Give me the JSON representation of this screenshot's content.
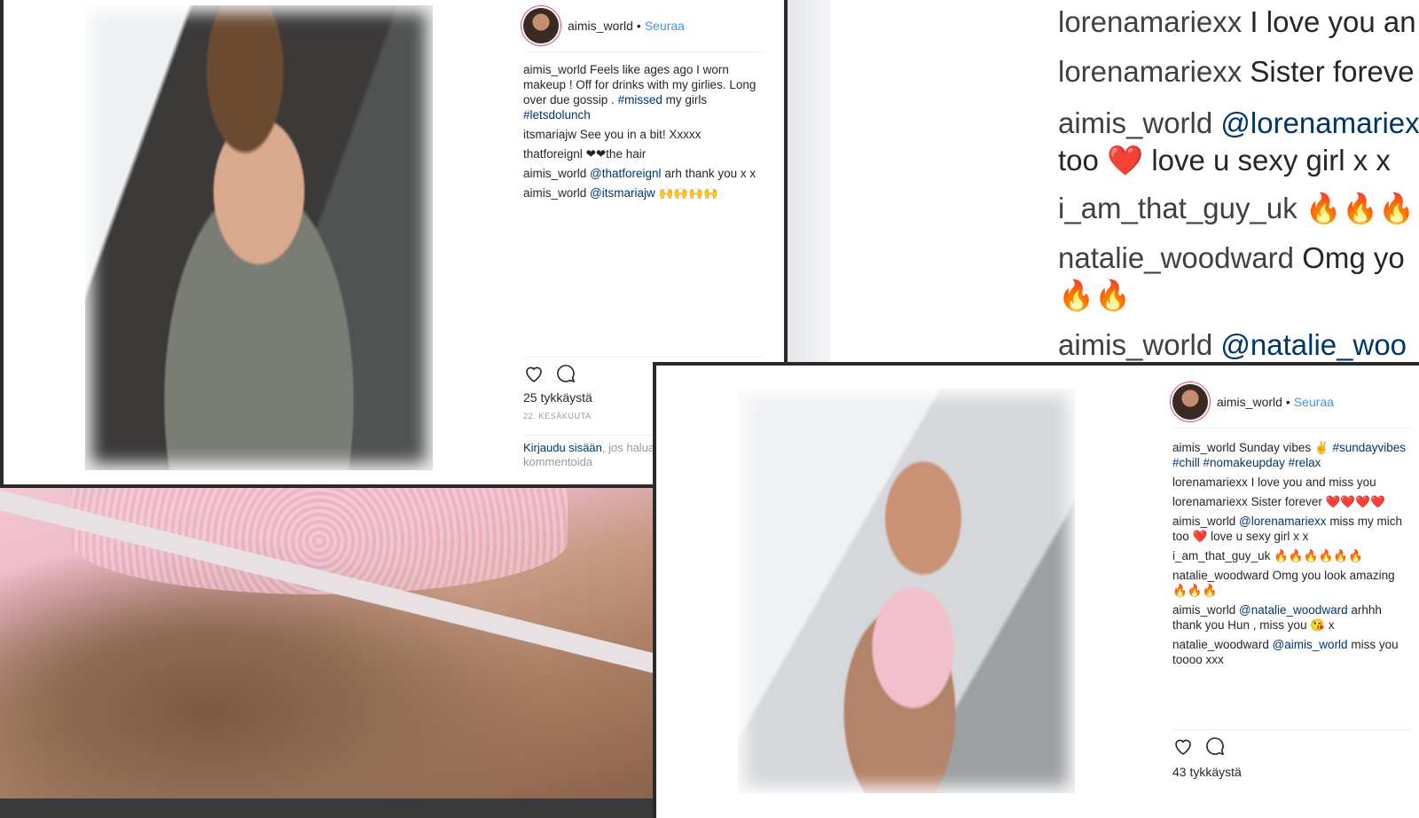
{
  "zoom_comments": [
    {
      "user": "lorenamariexx",
      "text": "I love you an"
    },
    {
      "user": "lorenamariexx",
      "text": "Sister foreve"
    },
    {
      "user": "aimis_world",
      "mention": "@lorenamariex",
      "text2": "too",
      "heart": "❤️",
      "text3": "love u sexy girl x x"
    },
    {
      "user": "i_am_that_guy_uk",
      "fire": "🔥🔥🔥🔥"
    },
    {
      "user": "natalie_woodward",
      "text": "Omg yo",
      "fire": "🔥🔥"
    },
    {
      "user": "aimis_world",
      "mention": "@natalie_woo"
    }
  ],
  "post_left": {
    "username": "aimis_world",
    "dot": "•",
    "follow_label": "Seuraa",
    "caption_user": "aimis_world",
    "caption_text": "Feels like ages ago I worn makeup ! Off for drinks with my girlies. Long over due gossip .",
    "caption_tag1": "#missed",
    "caption_mid": "my girls",
    "caption_tag2": "#letsdolunch",
    "comments": [
      {
        "user": "itsmariajw",
        "text": "See you in a bit! Xxxxx"
      },
      {
        "user": "thatforeignl",
        "text": "❤❤the hair"
      },
      {
        "user": "aimis_world",
        "mention": "@thatforeignl",
        "text": "arh thank you x x"
      },
      {
        "user": "aimis_world",
        "mention": "@itsmariajw",
        "text": "🙌🙌🙌🙌"
      }
    ],
    "likes": "25 tykkäystä",
    "date": "22. KESÄKUUTA",
    "login_link": "Kirjaudu sisään",
    "login_text": ", jos haluat kommentoida"
  },
  "post_right": {
    "username": "aimis_world",
    "dot": "•",
    "follow_label": "Seuraa",
    "caption_user": "aimis_world",
    "caption_text": "Sunday vibes ✌️",
    "caption_tags": "#sundayvibes #chill #nomakeupday #relax",
    "comments": [
      {
        "user": "lorenamariexx",
        "text": "I love you and miss you"
      },
      {
        "user": "lorenamariexx",
        "text": "Sister forever",
        "hearts": "❤️❤️❤️❤️"
      },
      {
        "user": "aimis_world",
        "mention": "@lorenamariexx",
        "text": "miss my mich too",
        "heart": "❤️",
        "text2": "love u sexy girl x x"
      },
      {
        "user": "i_am_that_guy_uk",
        "fire": "🔥🔥🔥🔥🔥🔥"
      },
      {
        "user": "natalie_woodward",
        "text": "Omg you look amazing",
        "fire": "🔥🔥🔥"
      },
      {
        "user": "aimis_world",
        "mention": "@natalie_woodward",
        "text": "arhhh thank you Hun , miss you",
        "emoji": "😘",
        "text2": "x"
      },
      {
        "user": "natalie_woodward",
        "mention": "@aimis_world",
        "text": "miss you toooo xxx"
      }
    ],
    "likes": "43 tykkäystä"
  }
}
